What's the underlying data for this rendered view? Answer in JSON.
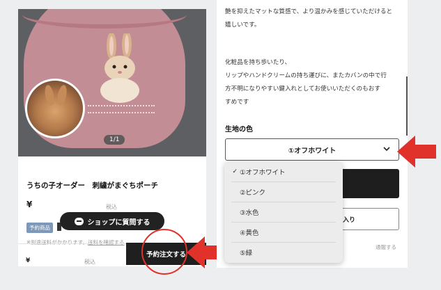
{
  "left": {
    "pager": "1/1",
    "product_title": "うちの子オーダー　刺繍がまぐちポーチ",
    "price_symbol": "¥",
    "tax_label": "税込",
    "badge": "予約商品",
    "shipping_note": "※別途送料がかかります。",
    "shipping_link": "送料を確認する",
    "chat_button": "ショップに質問する",
    "footer_price_symbol": "¥",
    "footer_tax_label": "税込",
    "order_button": "予約注文する"
  },
  "right": {
    "desc_lines": [
      "艶を抑えたマットな質感で、より温かみを感じていただけると",
      "嬉しいです。",
      "化粧品を持ち歩いたり、",
      "リップやハンドクリームの持ち運びに、またカバンの中で行",
      "方不明になりやすい鍵入れとしてお使いいただくのもおす",
      "すめです"
    ],
    "fabric_label": "生地の色",
    "selected_option": "①オフホワイト",
    "favorite_button": "入り",
    "report_link": "通報する"
  },
  "dropdown": {
    "options": [
      "①オフホワイト",
      "②ピンク",
      "③水色",
      "④黄色",
      "⑤緑"
    ],
    "selected_index": 0,
    "check_mark": "✓"
  },
  "colors": {
    "annotation_red": "#e0312a",
    "button_dark": "#1f1f1f",
    "badge_blue": "#7d98b8"
  }
}
